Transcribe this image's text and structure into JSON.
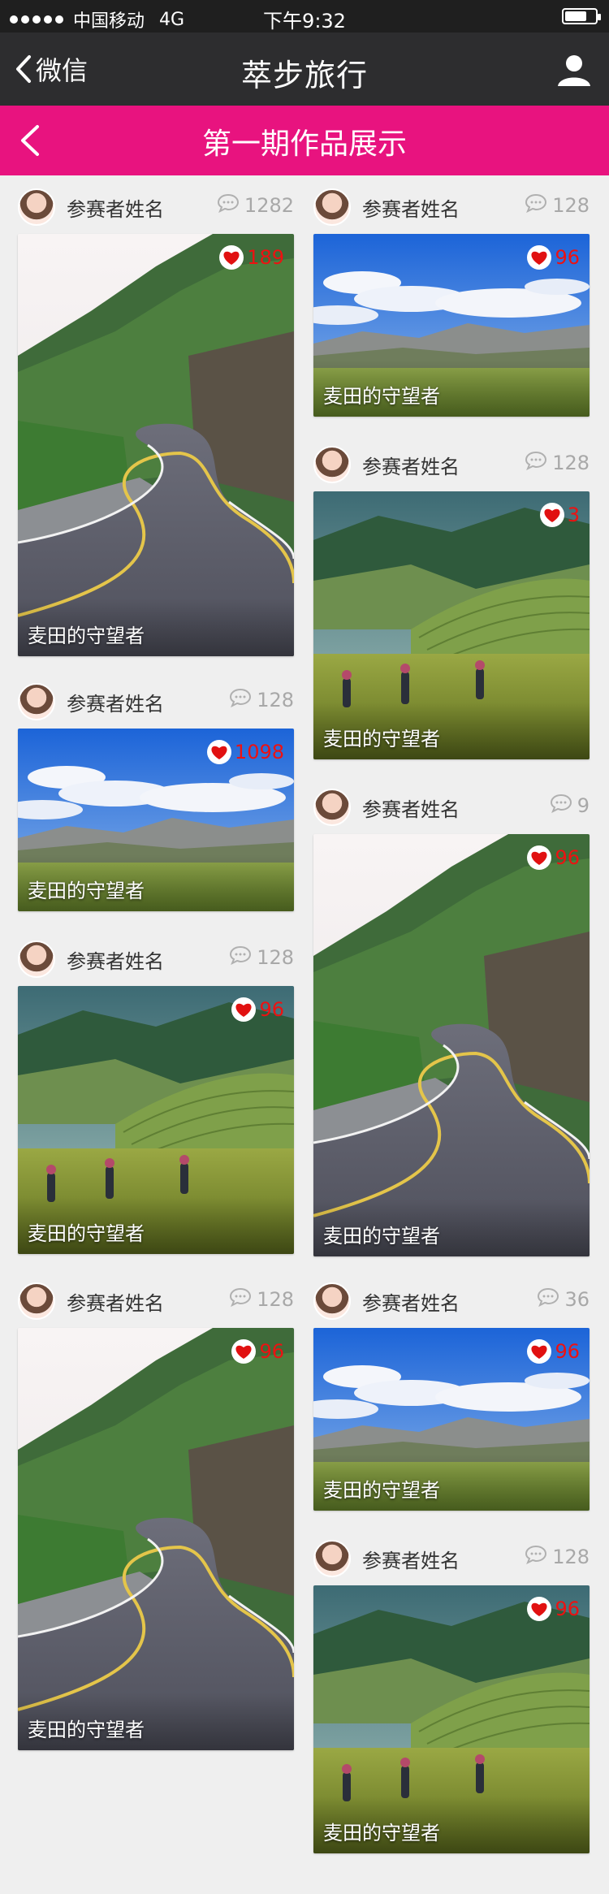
{
  "status_bar": {
    "carrier": "中国移动",
    "network": "4G",
    "time": "下午9:32"
  },
  "wechat_bar": {
    "back_label": "微信",
    "title": "萃步旅行"
  },
  "page_header": {
    "title": "第一期作品展示"
  },
  "colors": {
    "accent": "#e8137f",
    "like": "#e11111",
    "nav_dark": "#2d2d2f"
  },
  "cards": [
    {
      "author": "参赛者姓名",
      "comments": "1282",
      "likes": "189",
      "title": "麦田的守望者",
      "image": "mountain-road"
    },
    {
      "author": "参赛者姓名",
      "comments": "128",
      "likes": "96",
      "title": "麦田的守望者",
      "image": "blue-sky-field"
    },
    {
      "author": "参赛者姓名",
      "comments": "128",
      "likes": "3",
      "title": "麦田的守望者",
      "image": "rice-terraces"
    },
    {
      "author": "参赛者姓名",
      "comments": "128",
      "likes": "1098",
      "title": "麦田的守望者",
      "image": "blue-sky-field"
    },
    {
      "author": "参赛者姓名",
      "comments": "9",
      "likes": "96",
      "title": "麦田的守望者",
      "image": "mountain-road"
    },
    {
      "author": "参赛者姓名",
      "comments": "128",
      "likes": "96",
      "title": "麦田的守望者",
      "image": "rice-terraces"
    },
    {
      "author": "参赛者姓名",
      "comments": "128",
      "likes": "96",
      "title": "麦田的守望者",
      "image": "mountain-road"
    },
    {
      "author": "参赛者姓名",
      "comments": "36",
      "likes": "96",
      "title": "麦田的守望者",
      "image": "blue-sky-field"
    },
    {
      "author": "参赛者姓名",
      "comments": "128",
      "likes": "96",
      "title": "麦田的守望者",
      "image": "rice-terraces"
    }
  ]
}
